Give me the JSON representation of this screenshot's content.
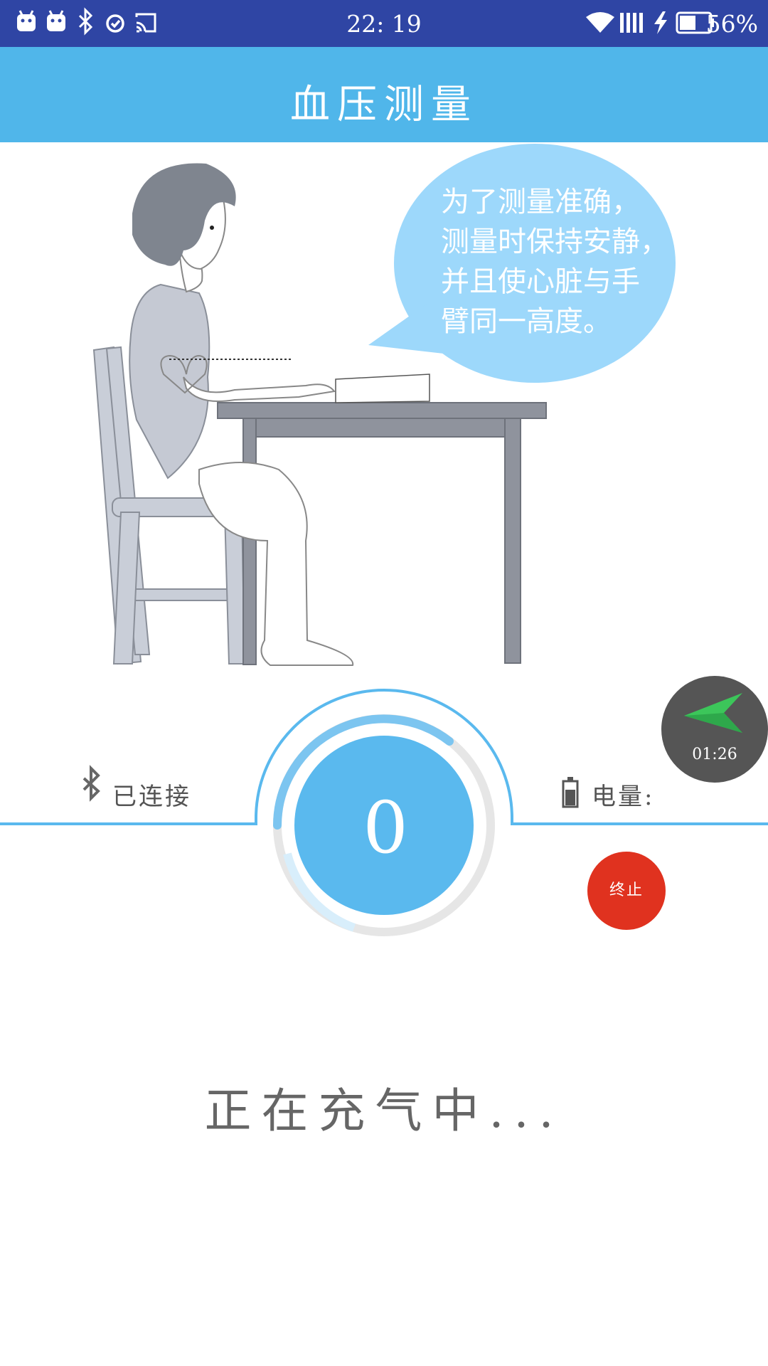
{
  "status_bar": {
    "time": "22: 19",
    "battery_percent": "56%",
    "icons": [
      "android-icon",
      "android-icon",
      "bluetooth-icon",
      "alarm-icon",
      "cast-icon",
      "wifi-icon",
      "signal-icon",
      "charging-icon",
      "battery-icon"
    ]
  },
  "header": {
    "title": "血压测量"
  },
  "illustration": {
    "bubble_lines": [
      "为了测量准确，",
      "测量时保持安静，",
      "并且使心脏与手",
      "臂同一高度。"
    ]
  },
  "connection": {
    "status": "已连接",
    "battery_label": "电量:"
  },
  "gauge": {
    "value": "0"
  },
  "timer": {
    "time": "01:26"
  },
  "stop_button": {
    "label": "终止"
  },
  "status_message": "正在充气中...",
  "colors": {
    "status_bar": "#2f45a4",
    "header": "#50b6ea",
    "bubble": "#9dd8fb",
    "gauge": "#5ab9ee",
    "stop": "#e0321f",
    "timer_bg": "#555555",
    "plane": "#3cc65a"
  }
}
